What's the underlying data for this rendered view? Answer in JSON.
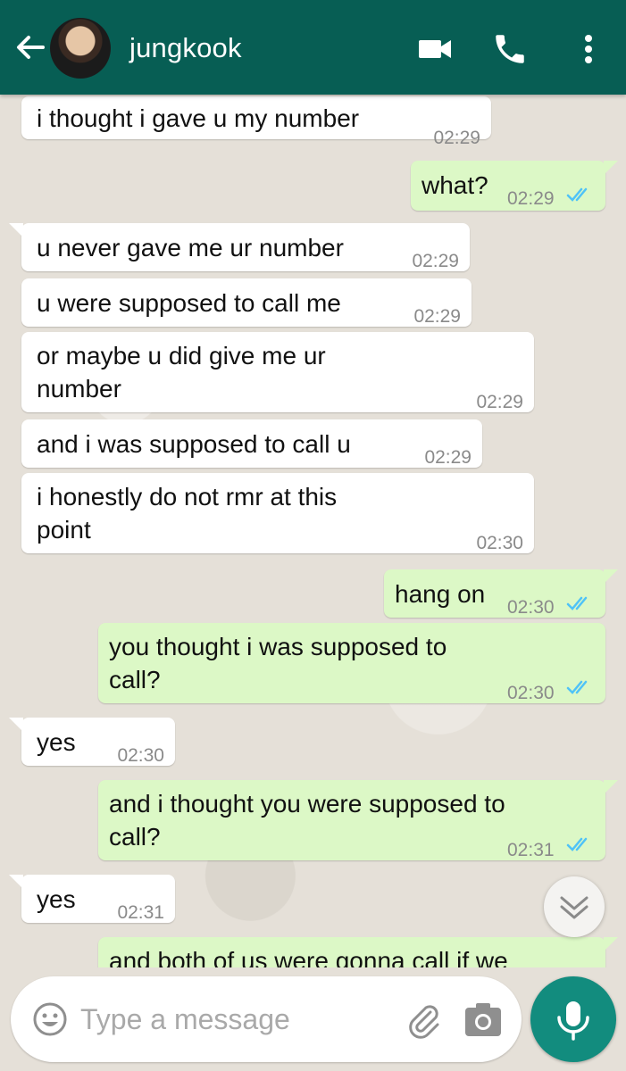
{
  "header": {
    "contact_name": "jungkook"
  },
  "composer": {
    "placeholder": "Type a message"
  },
  "messages": [
    {
      "text": "i thought i gave u my number",
      "time": "02:29"
    },
    {
      "text": "what?",
      "time": "02:29"
    },
    {
      "text": "u never gave me ur number",
      "time": "02:29"
    },
    {
      "text": "u were supposed to call me",
      "time": "02:29"
    },
    {
      "text": "or maybe u did give me ur\nnumber",
      "time": "02:29"
    },
    {
      "text": "and i was supposed to call u",
      "time": "02:29"
    },
    {
      "text": "i honestly do not rmr at this\npoint",
      "time": "02:30"
    },
    {
      "text": "hang on",
      "time": "02:30"
    },
    {
      "text": "you thought i was supposed to\ncall?",
      "time": "02:30"
    },
    {
      "text": "yes",
      "time": "02:30"
    },
    {
      "text": "and i thought you were supposed to\ncall?",
      "time": "02:31"
    },
    {
      "text": "yes",
      "time": "02:31"
    },
    {
      "text": "and both of us were gonna call if we",
      "time": ""
    }
  ],
  "colors": {
    "header": "#075e54",
    "outgoing_bubble": "#dcf8c6",
    "incoming_bubble": "#ffffff",
    "read_ticks": "#4fc3f7",
    "mic_button": "#128c7e"
  },
  "icons": {
    "back": "arrow-left-icon",
    "video": "video-camera-icon",
    "call": "phone-icon",
    "menu": "more-vertical-icon",
    "emoji": "smiley-icon",
    "attach": "paperclip-icon",
    "camera": "camera-icon",
    "mic": "microphone-icon",
    "scroll": "chevrons-down-icon"
  }
}
